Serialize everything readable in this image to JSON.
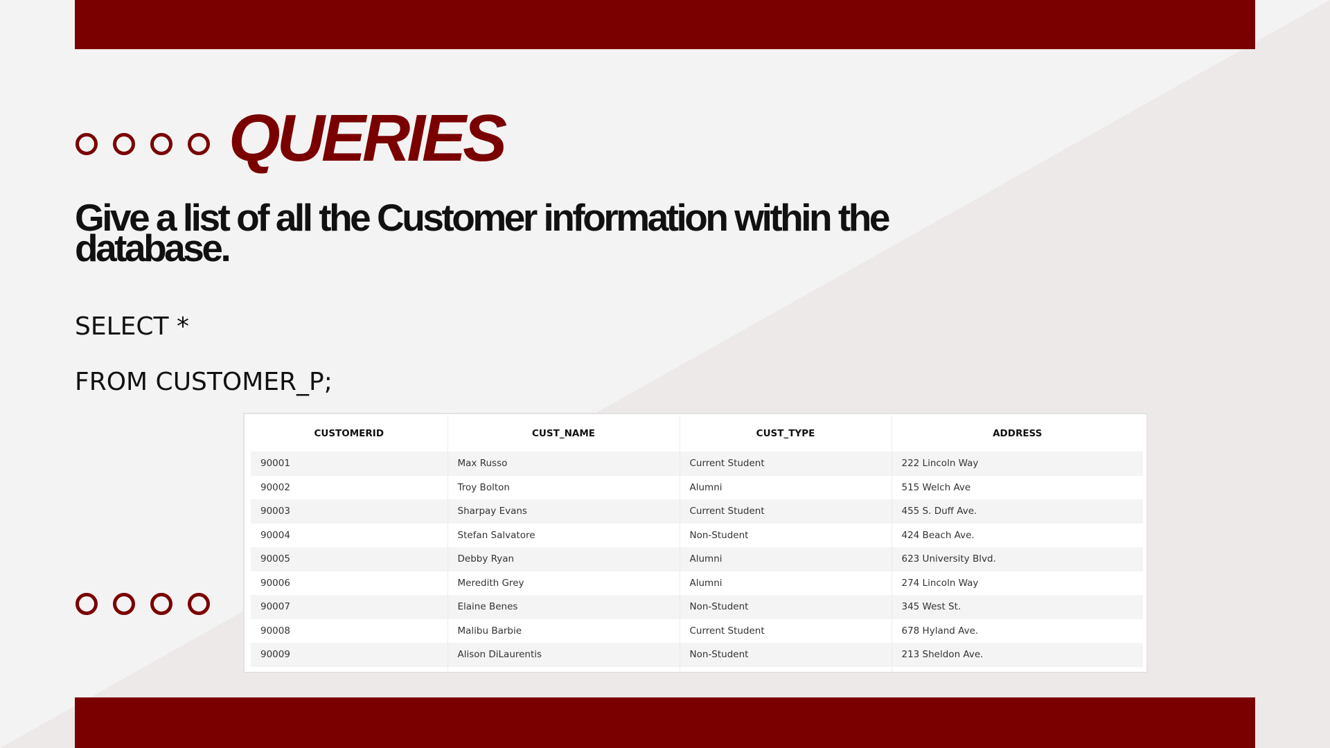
{
  "slide": {
    "title": "QUERIES",
    "question": "Give a list of all the Customer information within the database.",
    "sql": {
      "line1": "SELECT *",
      "line2": "FROM CUSTOMER_P;"
    }
  },
  "colors": {
    "accent": "#7a0000",
    "background": "#f4f3f3",
    "background_diagonal": "#eee9e9"
  },
  "result_table": {
    "columns": [
      "CUSTOMERID",
      "CUST_NAME",
      "CUST_TYPE",
      "ADDRESS"
    ],
    "rows": [
      [
        "90001",
        "Max Russo",
        "Current Student",
        "222 Lincoln Way"
      ],
      [
        "90002",
        "Troy Bolton",
        "Alumni",
        "515 Welch Ave"
      ],
      [
        "90003",
        "Sharpay Evans",
        "Current Student",
        "455 S. Duff Ave."
      ],
      [
        "90004",
        "Stefan Salvatore",
        "Non-Student",
        "424 Beach Ave."
      ],
      [
        "90005",
        "Debby Ryan",
        "Alumni",
        "623 University Blvd."
      ],
      [
        "90006",
        "Meredith Grey",
        "Alumni",
        "274 Lincoln Way"
      ],
      [
        "90007",
        "Elaine Benes",
        "Non-Student",
        "345 West St."
      ],
      [
        "90008",
        "Malibu Barbie",
        "Current Student",
        "678 Hyland Ave."
      ],
      [
        "90009",
        "Alison DiLaurentis",
        "Non-Student",
        "213 Sheldon Ave."
      ]
    ]
  }
}
